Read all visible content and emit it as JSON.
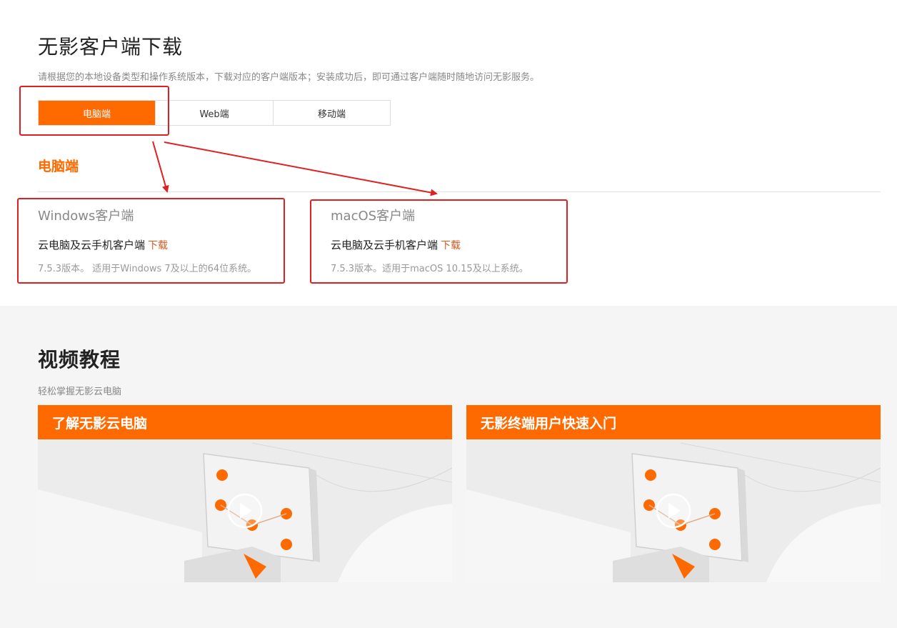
{
  "download": {
    "title": "无影客户端下载",
    "description": "请根据您的本地设备类型和操作系统版本，下载对应的客户端版本；安装成功后，即可通过客户端随时随地访问无影服务。",
    "tabs": [
      {
        "label": "电脑端"
      },
      {
        "label": "Web端"
      },
      {
        "label": "移动端"
      }
    ],
    "section_title": "电脑端",
    "clients": [
      {
        "name": "Windows客户端",
        "product": "云电脑及云手机客户端",
        "download_label": "下载",
        "meta": "7.5.3版本。 适用于Windows 7及以上的64位系统。"
      },
      {
        "name": "macOS客户端",
        "product": "云电脑及云手机客户端",
        "download_label": "下载",
        "meta": "7.5.3版本。适用于macOS 10.15及以上系统。"
      }
    ]
  },
  "videos": {
    "title": "视频教程",
    "subtitle": "轻松掌握无影云电脑",
    "items": [
      {
        "title": "了解无影云电脑"
      },
      {
        "title": "无影终端用户快速入门"
      }
    ]
  },
  "colors": {
    "accent": "#ff6a00",
    "annotation": "#e02020",
    "download_link": "#e4561a"
  }
}
